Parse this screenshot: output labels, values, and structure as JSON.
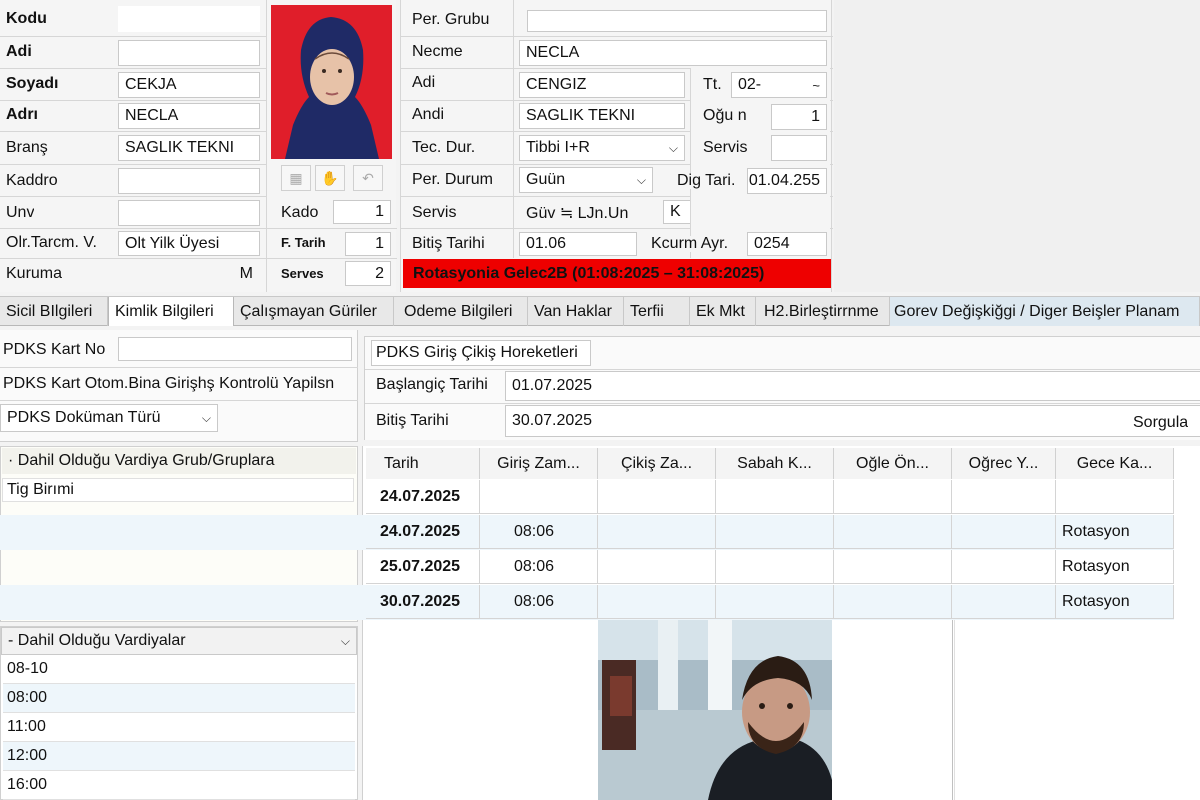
{
  "left_form": {
    "kodu_label": "Kodu",
    "kodu_value": "",
    "adi_label": "Adi",
    "adi_value": "",
    "soyadi_label": "Soyadı",
    "soyadi_value": "CEKJA",
    "adri_label": "Adrı",
    "adri_value": "NECLA",
    "brans_label": "Branş",
    "brans_value": "SAGLIK TEKNI",
    "kaddro_label": "Kaddro",
    "kaddro_value": "",
    "unv_label": "Unv",
    "unv_value": "",
    "olr_label": "Olr.Tarcm. V.",
    "olr_value": "Olt Yilk Üyesi",
    "kuruma_label": "Kuruma",
    "kuruma_value": "M"
  },
  "photo_panel": {
    "kado_label": "Kado",
    "kado_value": "1",
    "ftarih_label": "F. Tarih",
    "ftarih_value": "1",
    "serves_label": "Serves",
    "serves_value": "2"
  },
  "mid_form": {
    "per_grubu_label": "Per. Grubu",
    "per_grubu_value": "",
    "necme_label": "Necme",
    "necme_value": "NECLA",
    "adi_label": "Adi",
    "adi_value": "CENGIZ",
    "andi_label": "Andi",
    "andi_value": "SAGLIK TEKNI",
    "tec_dur_label": "Tec. Dur.",
    "tec_dur_value": "Tibbi I+R",
    "per_durum_label": "Per. Durum",
    "per_durum_value": "Guün",
    "servis_label": "Servis",
    "servis_value": "Güv ≒ LJn.Un",
    "servis_k_value": "K",
    "bitis_label": "Bitiş Tarihi",
    "bitis_value": "01.06",
    "alert_text": "Rotasyonia Gelec2B (01:08:2025 – 31:08:2025)"
  },
  "right_form": {
    "tt_label": "Tt.",
    "tt_value": "02-",
    "tt_extra": "~",
    "ogun_label": "Oğu n",
    "ogun_value": "1",
    "servis_label": "Servis",
    "servis_value": "",
    "dig_label": "Dig Tari.",
    "dig_value": "01.04.255",
    "kcurm_label": "Kcurm Ayr.",
    "kcurm_value": "0254"
  },
  "tabs": [
    "Sicil BIlgileri",
    "Kimlik Bilgileri",
    "Çalışmayan Güriler",
    "Odeme Bilgileri",
    "Van Haklar",
    "Terfii",
    "Ek Mkt",
    "H2.Birleştirrnme",
    "Gorev Değişkiğgi / Diger Beişler Planam"
  ],
  "pdks": {
    "kart_no_label": "PDKS Kart No",
    "kart_no_value": "",
    "kart_otom_label": "PDKS Kart Otom.Bina  Girişhş Kontrolü Yapilsn",
    "dokuman_turu_label": "PDKS Doküman Türü",
    "giris_cikis_title": "PDKS Giriş Çikiş Horeketleri",
    "baslangic_label": "Başlangiç Tarihi",
    "baslangic_value": "01.07.2025",
    "bitis_label": "Bitiş Tarihi",
    "bitis_value": "30.07.2025",
    "sorgula_label": "Sorgula"
  },
  "vardiya_grub": {
    "title": "· Dahil Olduğu Vardiya Grub/Gruplara",
    "item": "Tig Birımi"
  },
  "vardiyalar": {
    "title": "- Dahil Olduğu Vardiyalar",
    "items": [
      "08-10",
      "08:00",
      "11:00",
      "12:00",
      "16:00"
    ]
  },
  "grid": {
    "columns": [
      "Tarih",
      "Giriş Zam...",
      "Çikiş Za...",
      "Sabah K...",
      "Oğle Ön...",
      "Oğrec Y...",
      "Gece Ka..."
    ],
    "rows": [
      [
        "24.07.2025",
        "",
        "",
        "",
        "",
        "",
        ""
      ],
      [
        "24.07.2025",
        "08:06",
        "",
        "",
        "",
        "",
        "Rotasyon"
      ],
      [
        "25.07.2025",
        "08:06",
        "",
        "",
        "",
        "",
        "Rotasyon"
      ],
      [
        "30.07.2025",
        "08:06",
        "",
        "",
        "",
        "",
        "Rotasyon"
      ]
    ]
  },
  "colors": {
    "alert_bg": "#ee0000",
    "photo_bg": "#e01e2a",
    "row_alt": "#eef6fb"
  }
}
